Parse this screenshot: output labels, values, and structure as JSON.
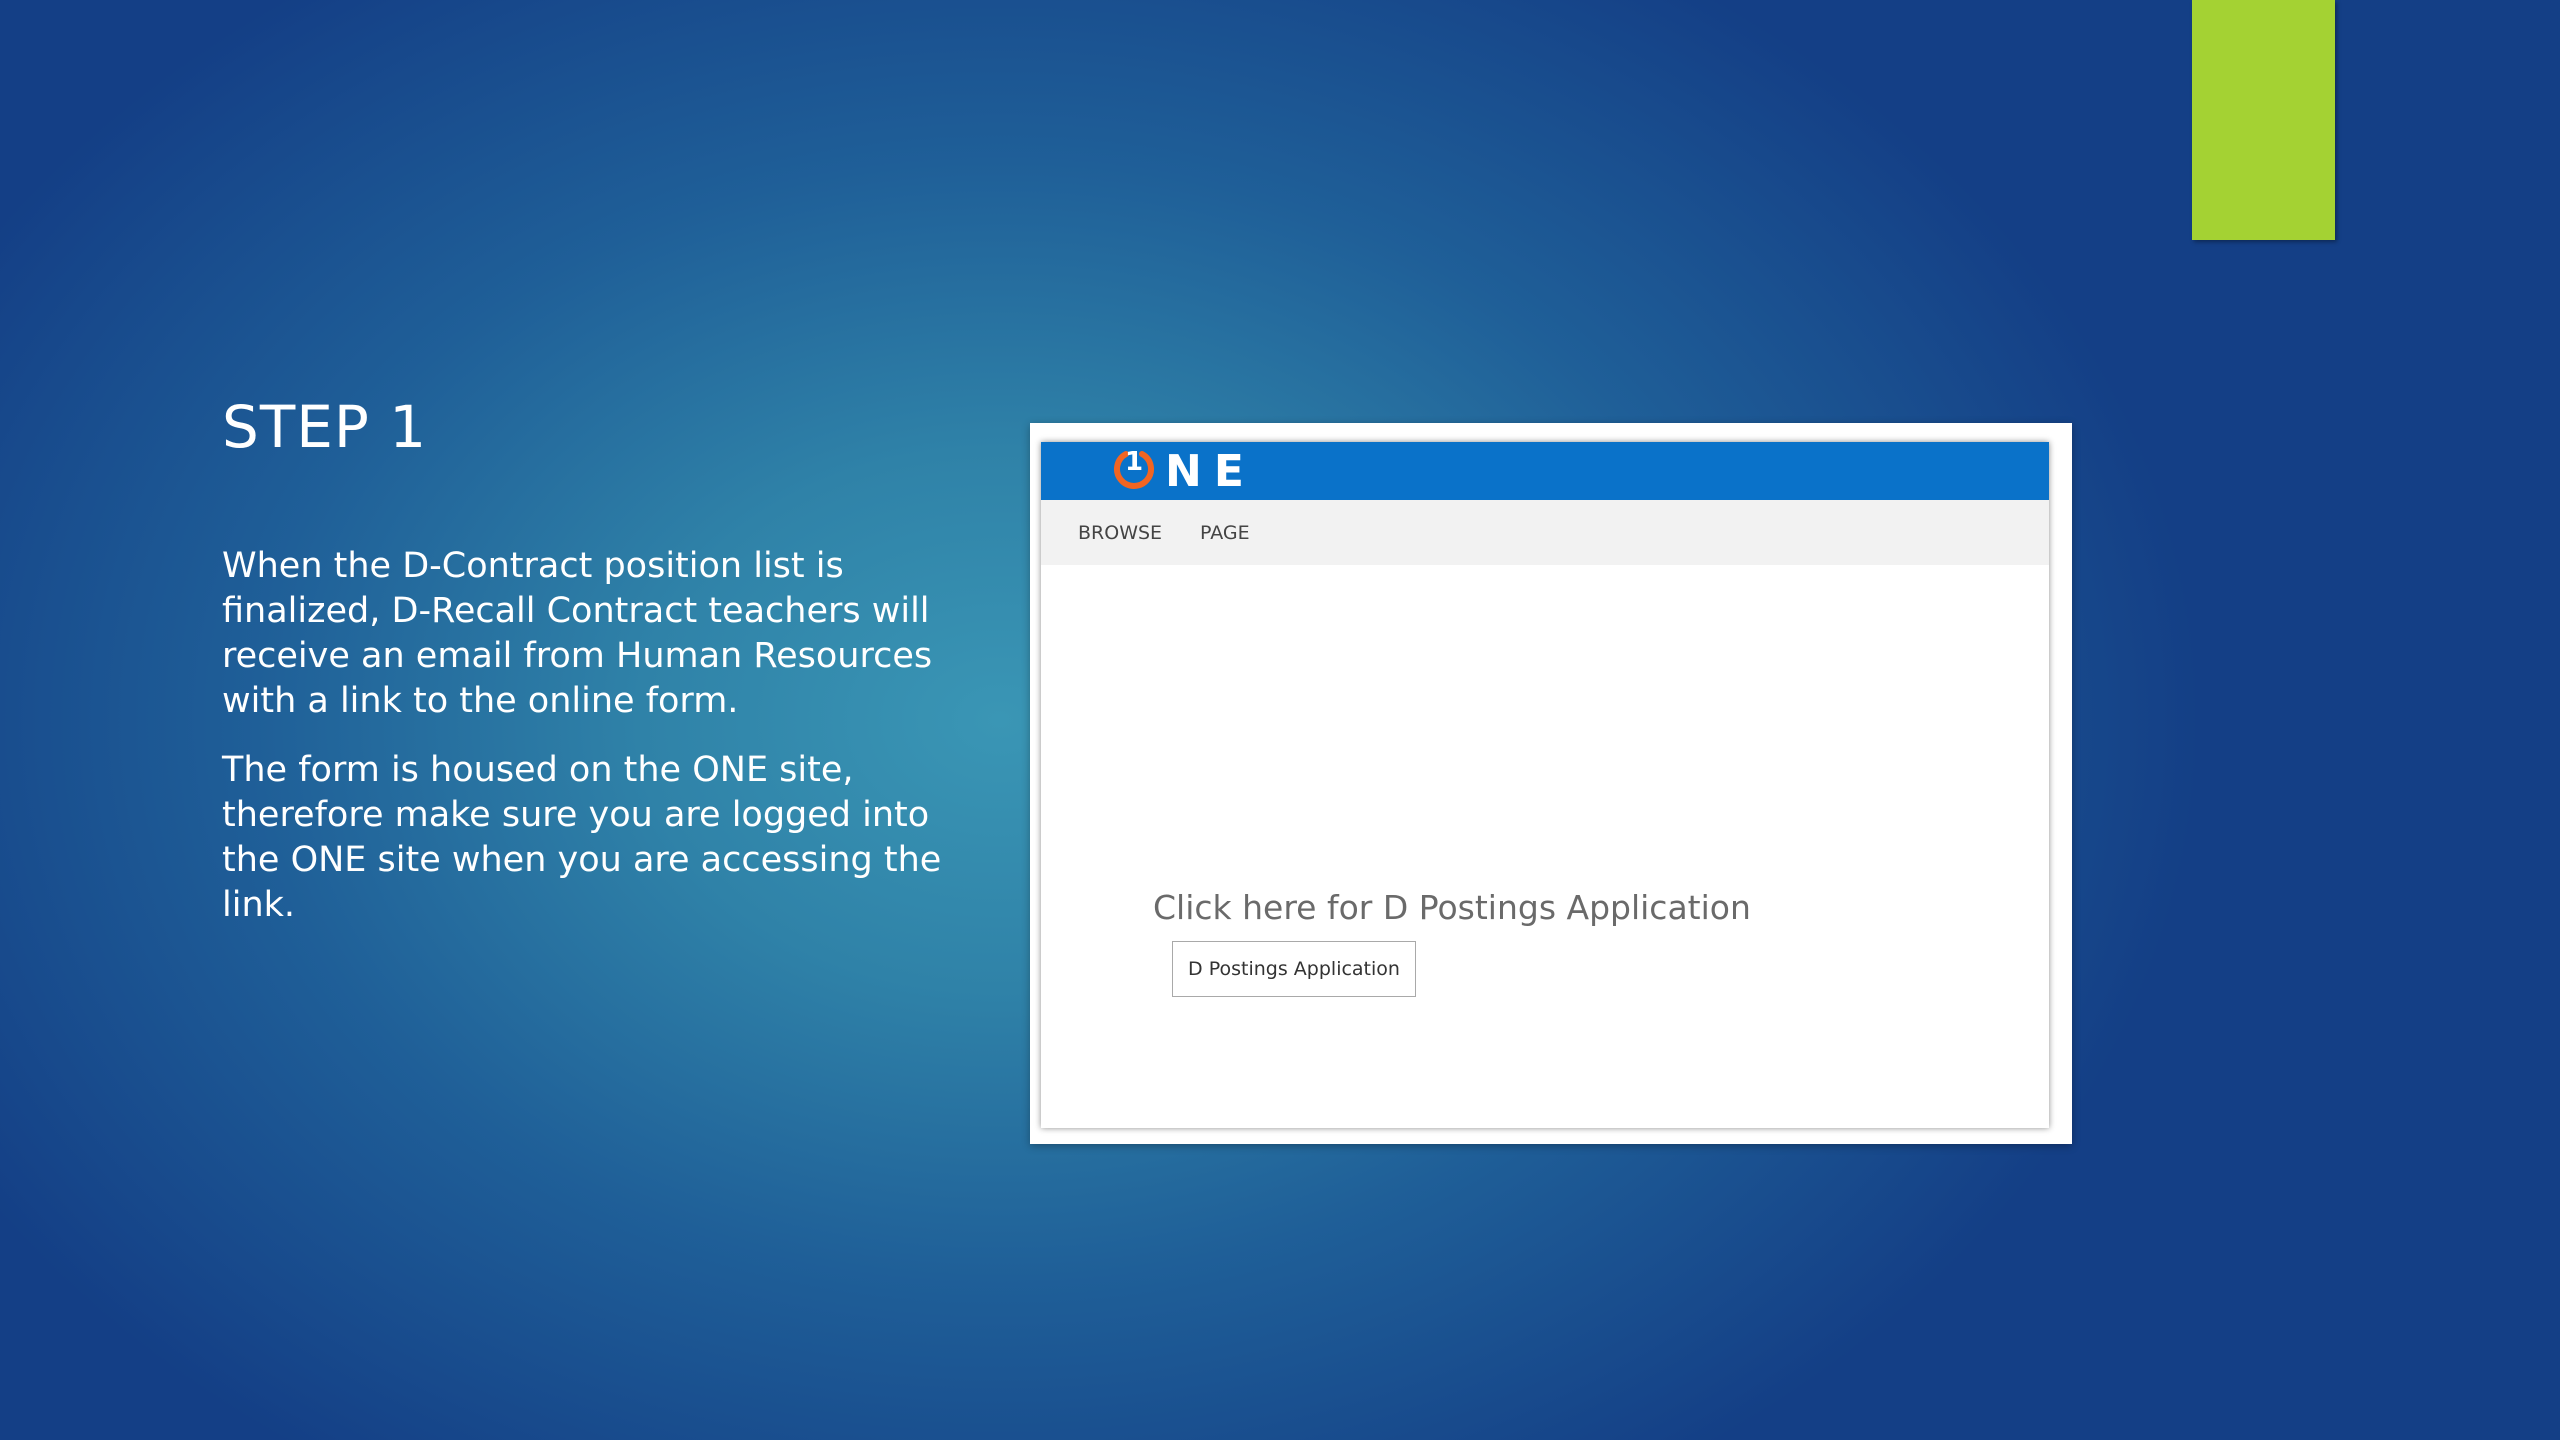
{
  "slide": {
    "title": "STEP 1",
    "paragraphs": [
      "When the D-Contract position list is finalized, D-Recall Contract teachers will receive an email from Human Resources with a link to the online form.",
      "The form is housed on the ONE site, therefore make sure you are logged into the ONE site when you are accessing the link."
    ]
  },
  "screenshot": {
    "logo": {
      "numeral": "1",
      "text": "NE",
      "icon": "one-power-logo-icon"
    },
    "ribbon_tabs": [
      "BROWSE",
      "PAGE"
    ],
    "content_heading": "Click here for D Postings Application",
    "button_label": "D Postings Application"
  },
  "colors": {
    "accent_bar": "#a4d233",
    "header_blue": "#0a72c9",
    "logo_orange": "#f26522",
    "background_dark": "#143f86",
    "background_light": "#3a96b5"
  }
}
